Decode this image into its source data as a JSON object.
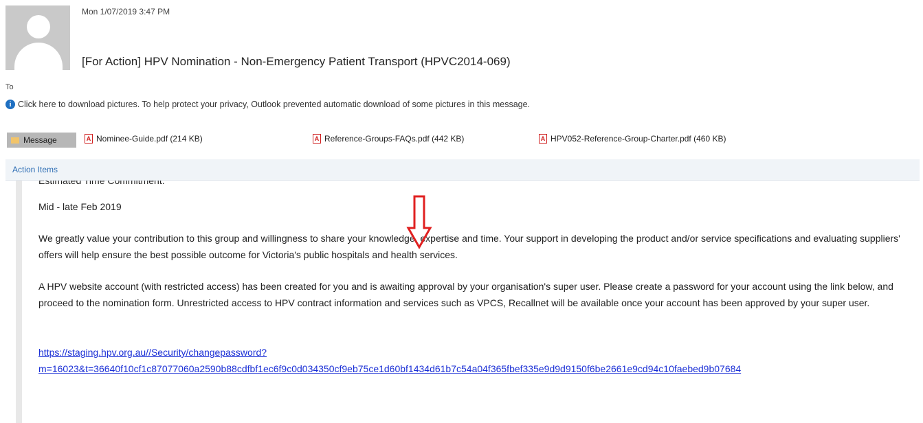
{
  "header": {
    "date": "Mon 1/07/2019 3:47 PM",
    "subject": "[For Action] HPV Nomination - Non-Emergency Patient Transport (HPVC2014-069)",
    "to_label": "To"
  },
  "info_bar": {
    "icon": "info-icon",
    "text": "Click here to download pictures. To help protect your privacy, Outlook prevented automatic download of some pictures in this message."
  },
  "attachments": {
    "message_tab": "Message",
    "files": [
      {
        "name": "Nominee-Guide.pdf (214 KB)"
      },
      {
        "name": "Reference-Groups-FAQs.pdf (442 KB)"
      },
      {
        "name": "HPV052-Reference-Group-Charter.pdf (460 KB)"
      }
    ]
  },
  "action_items": "Action Items",
  "body": {
    "cut_line": "Estimated Time Commitment:",
    "date_line": "Mid - late Feb 2019",
    "para1": "We greatly value your contribution to this group and willingness to share your knowledge, expertise and time. Your support in developing the product and/or service specifications and evaluating suppliers' offers will help ensure the best possible outcome for Victoria's public hospitals and health services.",
    "para2": "A HPV website account (with restricted access) has been created for you and is awaiting approval by your organisation's super user. Please create a password for your account using the link below, and proceed to the nomination form. Unrestricted access to HPV contract information and services such as VPCS, Recallnet will be available once your account has been approved by your super user.",
    "link_line1": "https://staging.hpv.org.au//Security/changepassword?",
    "link_line2": "m=16023&t=36640f10cf1c87077060a2590b88cdfbf1ec6f9c0d034350cf9eb75ce1d60bf1434d61b7c54a04f365fbef335e9d9d9150f6be2661e9cd94c10faebed9b07684"
  },
  "colors": {
    "accent_link": "#1a2fd6",
    "arrow": "#e02020",
    "action_text": "#2d6db4"
  }
}
